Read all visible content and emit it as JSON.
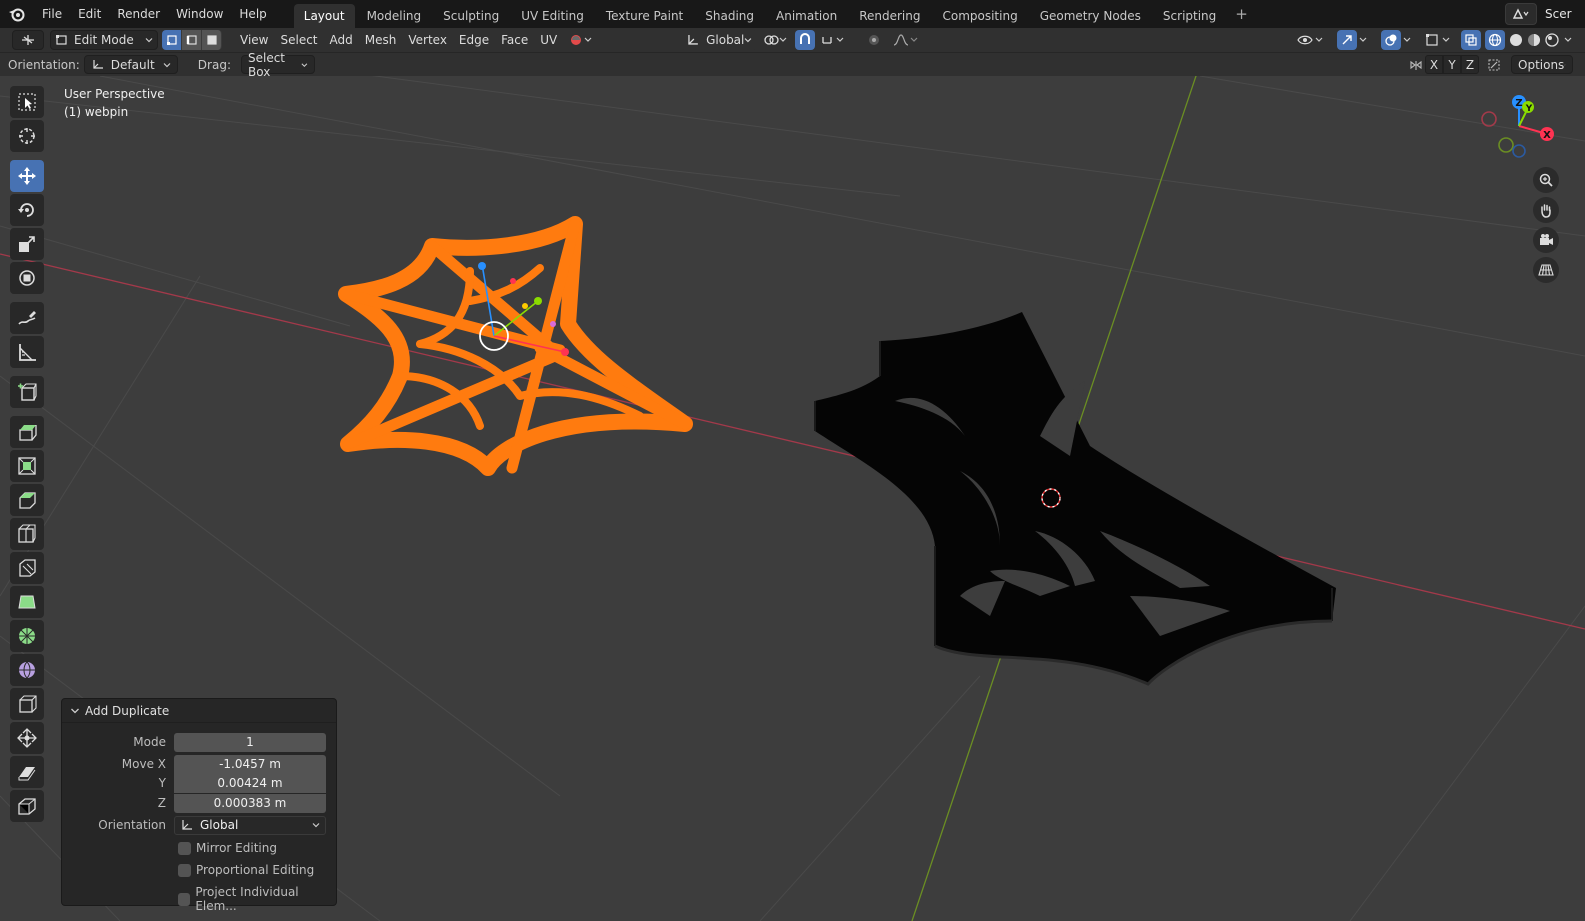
{
  "topbar": {
    "menus": [
      "File",
      "Edit",
      "Render",
      "Window",
      "Help"
    ],
    "workspaces": [
      "Layout",
      "Modeling",
      "Sculpting",
      "UV Editing",
      "Texture Paint",
      "Shading",
      "Animation",
      "Rendering",
      "Compositing",
      "Geometry Nodes",
      "Scripting"
    ],
    "active_workspace": "Layout",
    "scene_label": "Scer"
  },
  "header": {
    "mode": "Edit Mode",
    "menus": [
      "View",
      "Select",
      "Add",
      "Mesh",
      "Vertex",
      "Edge",
      "Face",
      "UV"
    ],
    "transform_orientation": "Global"
  },
  "toolsettings": {
    "orientation_label": "Orientation:",
    "orientation_value": "Default",
    "drag_label": "Drag:",
    "drag_value": "Select Box",
    "axis_x": "X",
    "axis_y": "Y",
    "axis_z": "Z",
    "options": "Options"
  },
  "viewport": {
    "view_name": "User Perspective",
    "object_name": "(1) webpin"
  },
  "gizmo": {
    "x": "X",
    "y": "Y",
    "z": "Z"
  },
  "operator_panel": {
    "title": "Add Duplicate",
    "mode_label": "Mode",
    "mode_value": "1",
    "move_x_label": "Move X",
    "move_x_value": "-1.0457 m",
    "move_y_label": "Y",
    "move_y_value": "0.00424 m",
    "move_z_label": "Z",
    "move_z_value": "0.000383 m",
    "orientation_label": "Orientation",
    "orientation_value": "Global",
    "mirror_editing": "Mirror Editing",
    "proportional_editing": "Proportional Editing",
    "project_individual": "Project Individual Elem..."
  },
  "colors": {
    "selected_mesh": "#ff7b0f",
    "x_axis": "#ff3352",
    "y_axis": "#8bdc00",
    "z_axis": "#2890ff",
    "active_tab": "#4772b3"
  }
}
